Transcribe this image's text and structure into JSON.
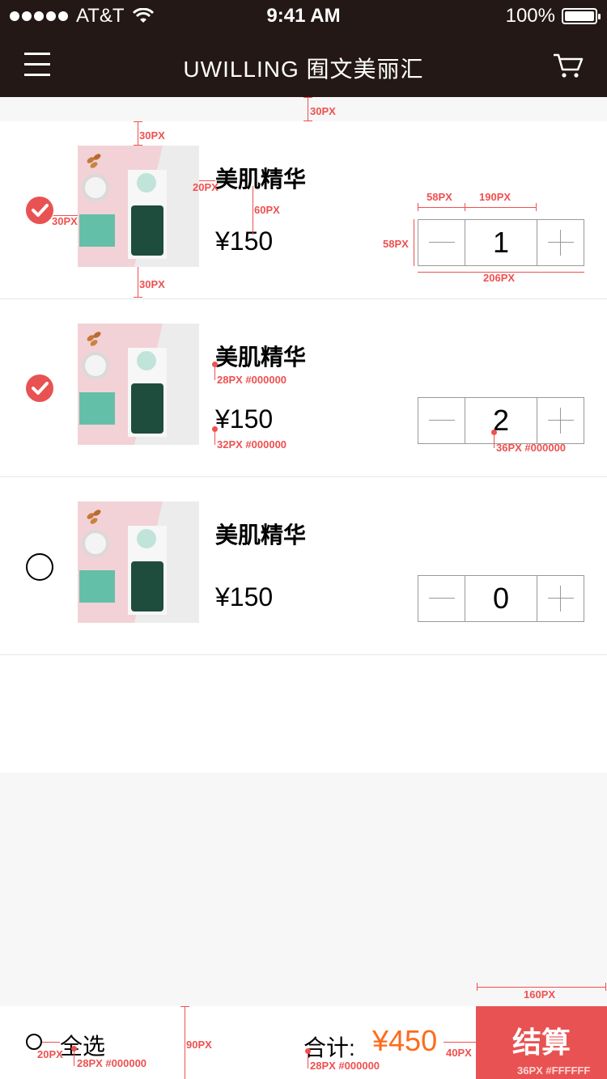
{
  "status_bar": {
    "carrier": "AT&T",
    "time": "9:41 AM",
    "battery": "100%"
  },
  "nav": {
    "title": "UWILLING 囿文美丽汇",
    "menu_icon": "menu-icon",
    "cart_icon": "cart-icon",
    "background": "#231815"
  },
  "items": [
    {
      "name": "美肌精华",
      "price": "¥150",
      "quantity": "1",
      "checked": true
    },
    {
      "name": "美肌精华",
      "price": "¥150",
      "quantity": "2",
      "checked": true
    },
    {
      "name": "美肌精华",
      "price": "¥150",
      "quantity": "0",
      "checked": false
    }
  ],
  "footer": {
    "select_all": "全选",
    "total_label": "合计:",
    "total_value": "¥450",
    "checkout_label": "结算"
  },
  "annotations": {
    "gap_top": "30PX",
    "gap_row_top": "30PX",
    "gap_check": "30PX",
    "gap_row_bottom": "30PX",
    "gap_text": "20PX",
    "gap_name_price": "60PX",
    "stepper_btn_w": "58PX",
    "stepper_mid_w": "190PX",
    "stepper_h": "58PX",
    "stepper_w": "206PX",
    "name_font": "28PX #000000",
    "price_font": "32PX #000000",
    "qty_font": "36PX #000000",
    "footer_h": "90PX",
    "footer_gap": "20PX",
    "selall_font": "28PX #000000",
    "total_font": "28PX #000000",
    "total_gap": "40PX",
    "checkout_w": "160PX",
    "checkout_font": "36PX #FFFFFF"
  },
  "colors": {
    "accent": "#e95252",
    "total": "#ff6a1a",
    "annotation": "#ef5050"
  }
}
